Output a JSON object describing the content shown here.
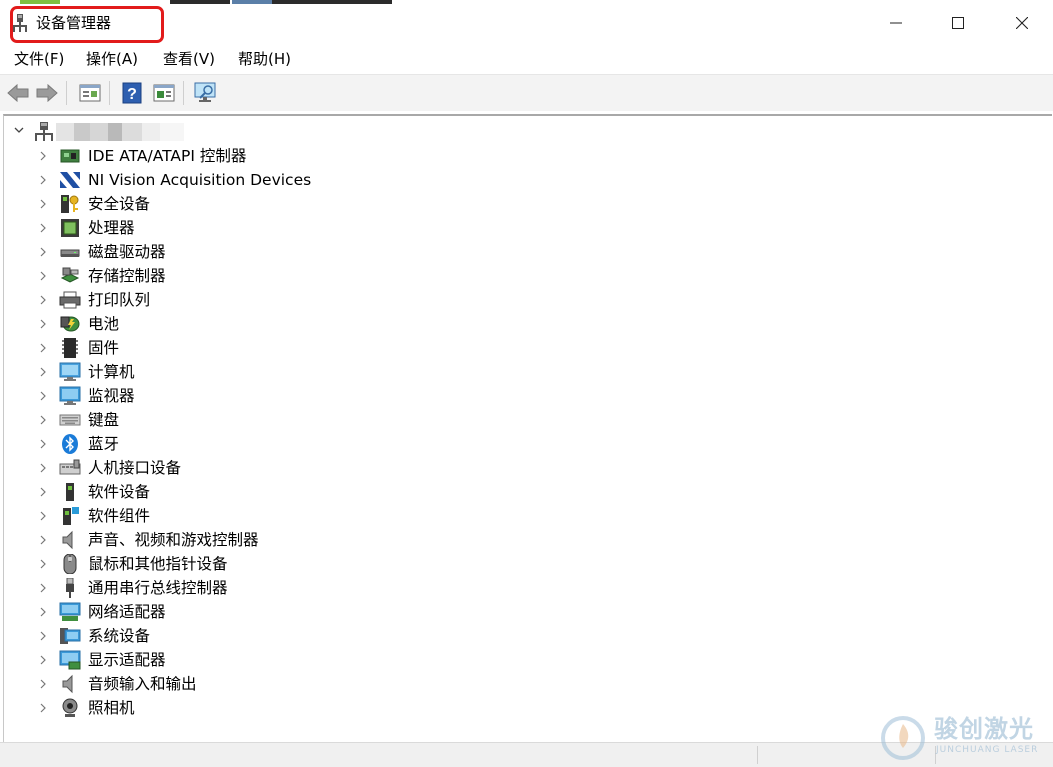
{
  "window": {
    "title": "设备管理器"
  },
  "menu": [
    {
      "label": "文件(F)"
    },
    {
      "label": "操作(A)"
    },
    {
      "label": "查看(V)"
    },
    {
      "label": "帮助(H)"
    }
  ],
  "toolbar_icons": [
    "back-arrow-icon",
    "forward-arrow-icon",
    "properties-icon",
    "help-icon",
    "driver-update-icon",
    "scan-monitor-icon"
  ],
  "tree": {
    "root_label_obscured": true,
    "categories": [
      {
        "label": "IDE ATA/ATAPI 控制器",
        "icon": "ide-controller-icon"
      },
      {
        "label": "NI Vision Acquisition Devices",
        "icon": "ni-logo-icon"
      },
      {
        "label": "安全设备",
        "icon": "security-key-icon"
      },
      {
        "label": "处理器",
        "icon": "processor-icon"
      },
      {
        "label": "磁盘驱动器",
        "icon": "disk-drive-icon"
      },
      {
        "label": "存储控制器",
        "icon": "storage-controller-icon"
      },
      {
        "label": "打印队列",
        "icon": "printer-icon"
      },
      {
        "label": "电池",
        "icon": "battery-icon"
      },
      {
        "label": "固件",
        "icon": "firmware-chip-icon"
      },
      {
        "label": "计算机",
        "icon": "computer-icon"
      },
      {
        "label": "监视器",
        "icon": "monitor-icon"
      },
      {
        "label": "键盘",
        "icon": "keyboard-icon"
      },
      {
        "label": "蓝牙",
        "icon": "bluetooth-icon"
      },
      {
        "label": "人机接口设备",
        "icon": "hid-icon"
      },
      {
        "label": "软件设备",
        "icon": "software-device-icon"
      },
      {
        "label": "软件组件",
        "icon": "software-component-icon"
      },
      {
        "label": "声音、视频和游戏控制器",
        "icon": "speaker-icon"
      },
      {
        "label": "鼠标和其他指针设备",
        "icon": "mouse-icon"
      },
      {
        "label": "通用串行总线控制器",
        "icon": "usb-icon"
      },
      {
        "label": "网络适配器",
        "icon": "network-adapter-icon"
      },
      {
        "label": "系统设备",
        "icon": "system-device-icon"
      },
      {
        "label": "显示适配器",
        "icon": "display-adapter-icon"
      },
      {
        "label": "音频输入和输出",
        "icon": "audio-io-icon"
      },
      {
        "label": "照相机",
        "icon": "camera-icon"
      }
    ]
  },
  "watermark": {
    "cn": "骏创激光",
    "en": "JUNCHUANG LASER"
  },
  "colors": {
    "highlight": "#e21b1b",
    "toolbar_bg": "#f3f3f3",
    "status_bg": "#f0f0f0"
  }
}
